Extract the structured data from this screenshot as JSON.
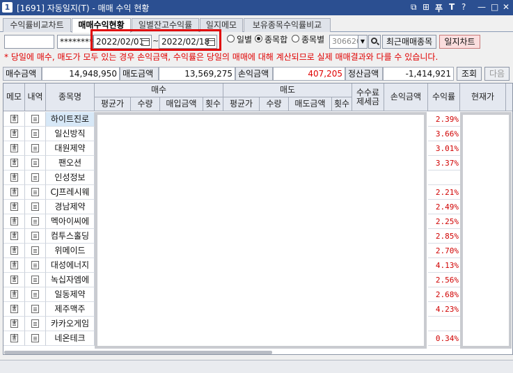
{
  "window": {
    "number": "1",
    "title": "[1691] 자동일지(T) - 매매 수익 현황",
    "buttons": [
      "⧉",
      "⊞",
      "푸",
      "T",
      "?",
      "—",
      "□",
      "✕"
    ]
  },
  "tabs": [
    {
      "label": "수익률비교차트",
      "active": false
    },
    {
      "label": "매매수익현황",
      "active": true
    },
    {
      "label": "일별잔고수익률",
      "active": false
    },
    {
      "label": "일지메모",
      "active": false
    },
    {
      "label": "보유종목수익률비교",
      "active": false
    }
  ],
  "controls": {
    "account": "",
    "password": "********",
    "date_from": "2022/02/01",
    "date_sep": "~",
    "date_to": "2022/02/18",
    "radio_daily": "일별",
    "radio_sum": "종목합",
    "radio_by_item": "종목별",
    "stock_code": "306620",
    "recent_btn": "최근매매종목",
    "chart_btn": "일지차트"
  },
  "warning": "* 당일에 매수, 매도가 모두 있는 경우 손익금액, 수익률은 당일의 매매에 대해 계산되므로 실제 매매결과와 다를 수 있습니다.",
  "summary": {
    "buy_label": "매수금액",
    "buy_value": "14,948,950",
    "sell_label": "매도금액",
    "sell_value": "13,569,275",
    "pl_label": "손익금액",
    "pl_value": "407,205",
    "settle_label": "정산금액",
    "settle_value": "-1,414,921",
    "query_btn": "조회",
    "next_btn": "다음"
  },
  "headers": {
    "memo": "메모",
    "detail": "내역",
    "name": "종목명",
    "buy": "매수",
    "sell": "매도",
    "buy_avg": "평균가",
    "buy_qty": "수량",
    "buy_amt": "매입금액",
    "buy_cnt": "횟수",
    "sell_avg": "평균가",
    "sell_qty": "수량",
    "sell_amt": "매도금액",
    "sell_cnt": "횟수",
    "fee": "수수료\n제세금",
    "pl": "손익금액",
    "rate": "수익률",
    "price": "현재가"
  },
  "rows": [
    {
      "name": "하이트진로",
      "rate": "2.39%"
    },
    {
      "name": "일신방직",
      "rate": "3.66%"
    },
    {
      "name": "대원제약",
      "rate": "3.01%"
    },
    {
      "name": "팬오션",
      "rate": "3.37%"
    },
    {
      "name": "인성정보",
      "rate": ""
    },
    {
      "name": "CJ프레시웨",
      "rate": "2.21%"
    },
    {
      "name": "경남제약",
      "rate": "2.49%"
    },
    {
      "name": "멕아이씨에",
      "rate": "2.25%"
    },
    {
      "name": "컴투스홀딩",
      "rate": "2.85%"
    },
    {
      "name": "위메이드",
      "rate": "2.70%"
    },
    {
      "name": "대성에너지",
      "rate": "4.13%"
    },
    {
      "name": "녹십자엠에",
      "rate": "2.56%"
    },
    {
      "name": "일동제약",
      "rate": "2.68%"
    },
    {
      "name": "제주맥주",
      "rate": "4.23%"
    },
    {
      "name": "카카오게임",
      "rate": ""
    },
    {
      "name": "네온테크",
      "rate": "0.34%"
    }
  ],
  "colors": {
    "accent": "#2b4f91",
    "warning": "#e00000",
    "highlight": "#e00000"
  }
}
